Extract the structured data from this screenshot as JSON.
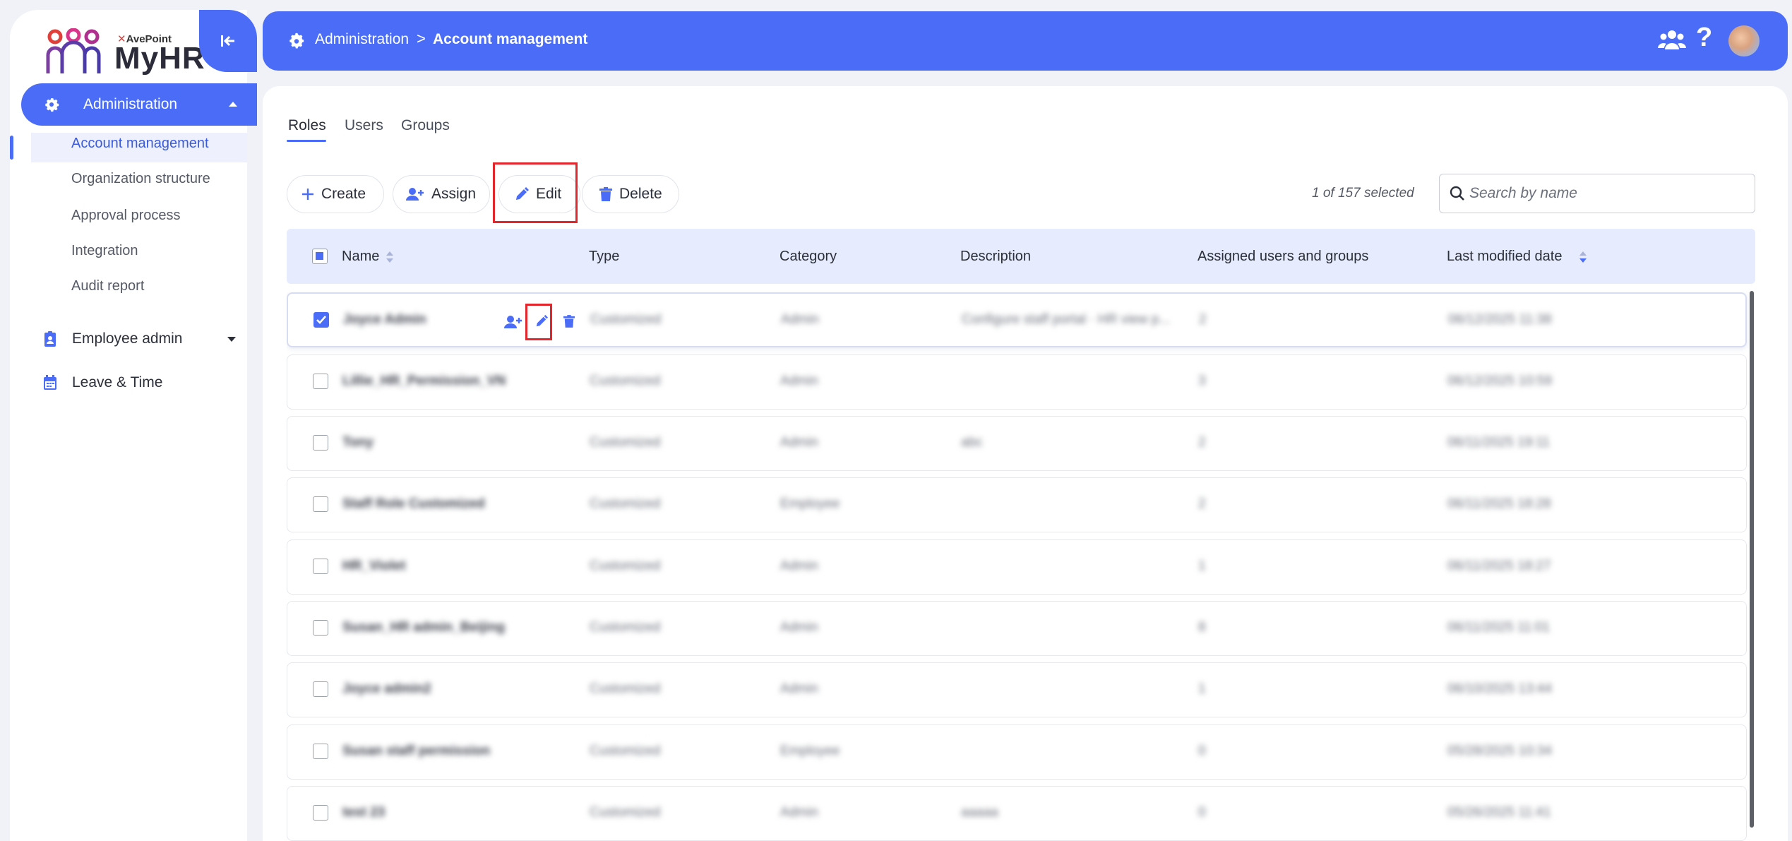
{
  "sidebar": {
    "brand": "AvePoint",
    "product": "MyHR",
    "admin_label": "Administration",
    "sub_items": [
      {
        "label": "Account management",
        "active": true
      },
      {
        "label": "Organization structure"
      },
      {
        "label": "Approval process"
      },
      {
        "label": "Integration"
      },
      {
        "label": "Audit report"
      }
    ],
    "employee_admin": "Employee admin",
    "leave_time": "Leave & Time"
  },
  "header": {
    "breadcrumb_root": "Administration",
    "breadcrumb_sep": ">",
    "breadcrumb_current": "Account management",
    "help": "?"
  },
  "tabs": [
    "Roles",
    "Users",
    "Groups"
  ],
  "toolbar": {
    "create": "Create",
    "assign": "Assign",
    "edit": "Edit",
    "delete": "Delete",
    "selected_count": "1 of 157 selected"
  },
  "search": {
    "placeholder": "Search by name"
  },
  "table": {
    "headers": [
      "Name",
      "Type",
      "Category",
      "Description",
      "Assigned users and groups",
      "Last modified date"
    ],
    "rows": [
      {
        "name": "Joyce Admin",
        "type": "Customized",
        "category": "Admin",
        "description": "Configure staff portal · HR view p...",
        "assigned": "2",
        "modified": "06/12/2025 11:38",
        "selected": true
      },
      {
        "name": "Lillie_HR_Permission_VN",
        "type": "Customized",
        "category": "Admin",
        "description": "",
        "assigned": "3",
        "modified": "06/12/2025 10:59"
      },
      {
        "name": "Tony",
        "type": "Customized",
        "category": "Admin",
        "description": "abc",
        "assigned": "2",
        "modified": "06/11/2025 19:11"
      },
      {
        "name": "Staff Role Customized",
        "type": "Customized",
        "category": "Employee",
        "description": "",
        "assigned": "2",
        "modified": "06/11/2025 18:28"
      },
      {
        "name": "HR_Violet",
        "type": "Customized",
        "category": "Admin",
        "description": "",
        "assigned": "1",
        "modified": "06/11/2025 18:27"
      },
      {
        "name": "Susan_HR admin_Beijing",
        "type": "Customized",
        "category": "Admin",
        "description": "",
        "assigned": "8",
        "modified": "06/11/2025 11:01"
      },
      {
        "name": "Joyce admin2",
        "type": "Customized",
        "category": "Admin",
        "description": "",
        "assigned": "1",
        "modified": "06/10/2025 13:44"
      },
      {
        "name": "Susan staff permission",
        "type": "Customized",
        "category": "Employee",
        "description": "",
        "assigned": "0",
        "modified": "05/28/2025 10:34"
      },
      {
        "name": "test 23",
        "type": "Customized",
        "category": "Admin",
        "description": "aaaaa",
        "assigned": "0",
        "modified": "05/26/2025 11:41"
      }
    ]
  },
  "colors": {
    "accent": "#4a6cf7",
    "highlight": "#e3262b",
    "header_bg": "#e6ebfd"
  }
}
